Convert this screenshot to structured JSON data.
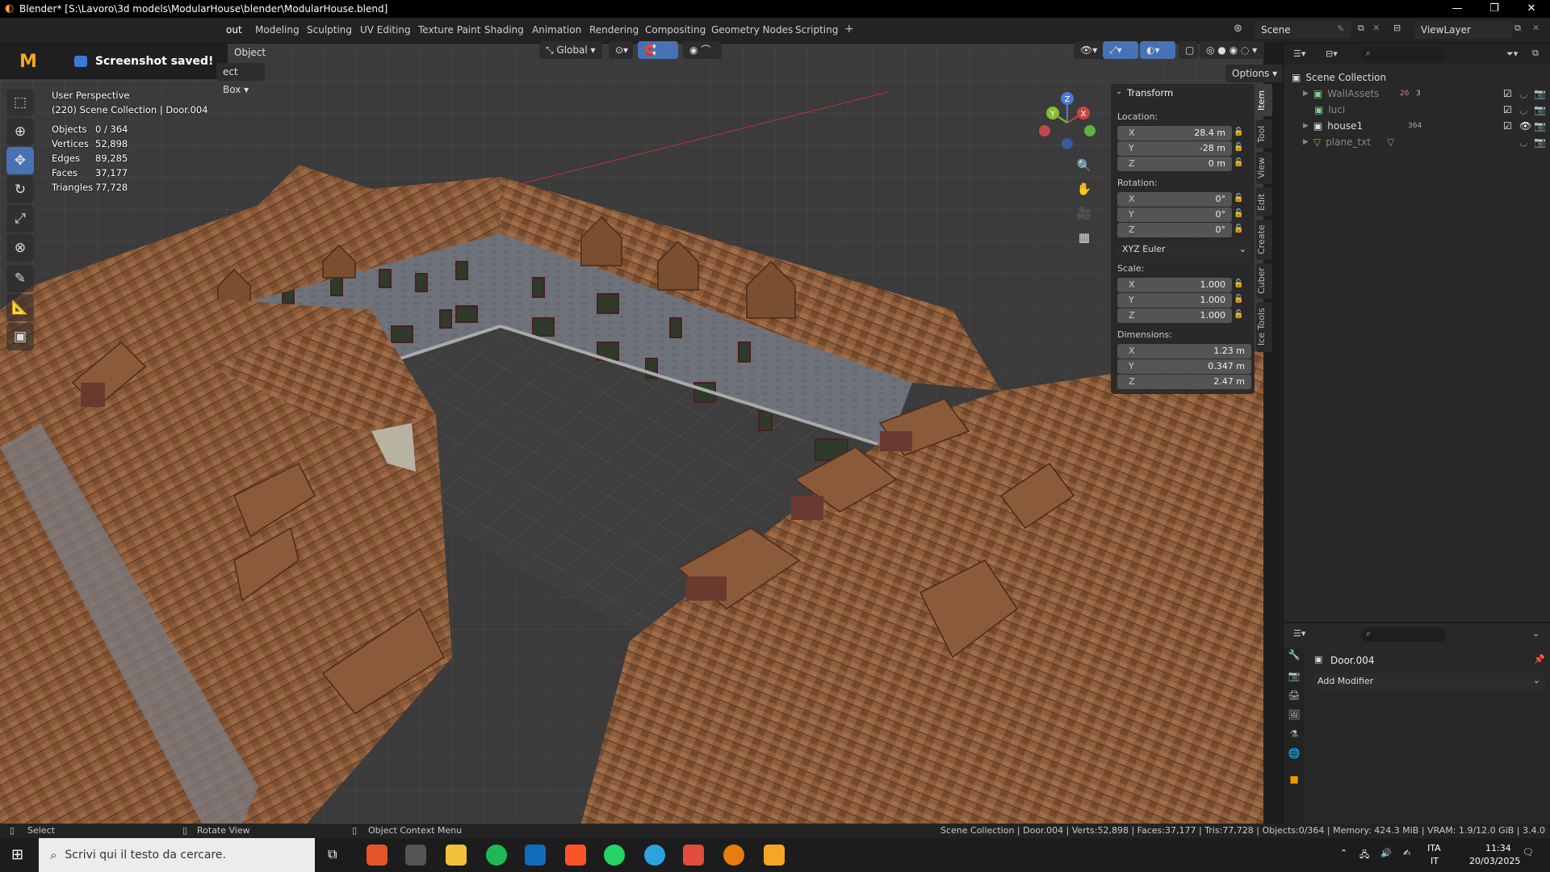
{
  "window": {
    "title": "Blender* [S:\\Lavoro\\3d models\\ModularHouse\\blender\\ModularHouse.blend]",
    "controls": [
      "—",
      "❐",
      "✕"
    ]
  },
  "toast": {
    "message": "Screenshot saved!",
    "logo": "M"
  },
  "workspaces": [
    "Layout",
    "Modeling",
    "Sculpting",
    "UV Editing",
    "Texture Paint",
    "Shading",
    "Animation",
    "Rendering",
    "Compositing",
    "Geometry Nodes",
    "Scripting"
  ],
  "workspace_visible_labels": [
    "out",
    "Modeling",
    "Sculpting",
    "UV Editing",
    "Texture Paint",
    "Shading",
    "Animation",
    "Rendering",
    "Compositing",
    "Geometry Nodes",
    "Scripting"
  ],
  "scene": {
    "name": "Scene",
    "view_layer": "ViewLayer"
  },
  "viewport_header": {
    "mode_label": "Object",
    "select_label": "ect Box",
    "orientation": "Global",
    "options_label": "Options"
  },
  "viewport_info": {
    "perspective": "User Perspective",
    "collection": "(220) Scene Collection | Door.004",
    "stats": [
      {
        "k": "Objects",
        "v": "0 / 364"
      },
      {
        "k": "Vertices",
        "v": "52,898"
      },
      {
        "k": "Edges",
        "v": "89,285"
      },
      {
        "k": "Faces",
        "v": "37,177"
      },
      {
        "k": "Triangles",
        "v": "77,728"
      }
    ]
  },
  "npanel": {
    "section": "Transform",
    "location_label": "Location:",
    "location": [
      {
        "ax": "X",
        "v": "28.4 m"
      },
      {
        "ax": "Y",
        "v": "-28 m"
      },
      {
        "ax": "Z",
        "v": "0 m"
      }
    ],
    "rotation_label": "Rotation:",
    "rotation": [
      {
        "ax": "X",
        "v": "0°"
      },
      {
        "ax": "Y",
        "v": "0°"
      },
      {
        "ax": "Z",
        "v": "0°"
      }
    ],
    "rotation_mode": "XYZ Euler",
    "scale_label": "Scale:",
    "scale": [
      {
        "ax": "X",
        "v": "1.000"
      },
      {
        "ax": "Y",
        "v": "1.000"
      },
      {
        "ax": "Z",
        "v": "1.000"
      }
    ],
    "dimensions_label": "Dimensions:",
    "dimensions": [
      {
        "ax": "X",
        "v": "1.23 m"
      },
      {
        "ax": "Y",
        "v": "0.347 m"
      },
      {
        "ax": "Z",
        "v": "2.47 m"
      }
    ],
    "tabs": [
      "Item",
      "Tool",
      "View",
      "Edit",
      "Create",
      "Cuber",
      "Ice Tools"
    ]
  },
  "gizmo": {
    "x": "X",
    "y": "Y",
    "z": "Z"
  },
  "outliner": {
    "root": "Scene Collection",
    "items": [
      {
        "name": "WallAssets",
        "badge": "26",
        "badge2": "3"
      },
      {
        "name": "luci",
        "badge": "",
        "badge2": ""
      },
      {
        "name": "house1",
        "badge": "364",
        "badge2": ""
      },
      {
        "name": "plane_txt",
        "badge": "",
        "badge2": ""
      }
    ]
  },
  "properties": {
    "object_name": "Door.004",
    "add_modifier": "Add Modifier"
  },
  "statusbar": {
    "select": "Select",
    "rotate": "Rotate View",
    "context_menu": "Object Context Menu",
    "info": "Scene Collection | Door.004 | Verts:52,898 | Faces:37,177 | Tris:77,728 | Objects:0/364 | Memory: 424.3 MiB | VRAM: 1.9/12.0 GiB | 3.4.0"
  },
  "taskbar": {
    "search_placeholder": "Scrivi qui il testo da cercare.",
    "lang1": "ITA",
    "lang2": "IT",
    "time": "11:34",
    "date": "20/03/2025"
  },
  "colors": {
    "accent": "#4772b3",
    "roof": "#8a5a3a",
    "wall": "#6c7078",
    "ground": "#4a4a4a"
  }
}
